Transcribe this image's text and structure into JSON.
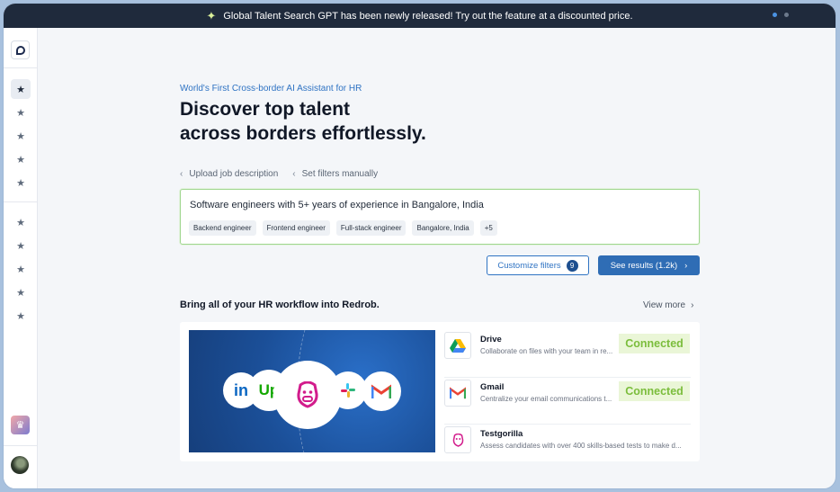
{
  "banner": {
    "text": "Global Talent Search GPT has been newly released! Try out the feature at a discounted price."
  },
  "main": {
    "kicker": "World's First Cross-border AI Assistant for HR",
    "headline_line1": "Discover top talent",
    "headline_line2": "across borders effortlessly.",
    "tabs": [
      {
        "label": "Upload job description"
      },
      {
        "label": "Set filters manually"
      }
    ],
    "search": {
      "query": "Software engineers with 5+ years of experience in Bangalore, India",
      "chips": [
        "Backend engineer",
        "Frontend engineer",
        "Full-stack engineer",
        "Bangalore, India",
        "+5"
      ]
    },
    "customize_label": "Customize filters",
    "customize_count": "9",
    "results_label": "See results (1.2k)"
  },
  "integrations": {
    "title": "Bring all of your HR workflow into Redrob.",
    "view_more": "View more",
    "items": [
      {
        "name": "Drive",
        "description": "Collaborate on files with your team in re...",
        "status": "Connected"
      },
      {
        "name": "Gmail",
        "description": "Centralize your email communications t...",
        "status": "Connected"
      },
      {
        "name": "Testgorilla",
        "description": "Assess candidates with over 400 skills-based tests to make d..."
      }
    ]
  },
  "hero_logos": {
    "linkedin": "in",
    "upwork": "Up"
  },
  "colors": {
    "accent": "#2f73c3",
    "banner_bg": "#1f2a3c",
    "connected_bg": "#eaf6d7",
    "connected_text": "#7bbd3c"
  }
}
